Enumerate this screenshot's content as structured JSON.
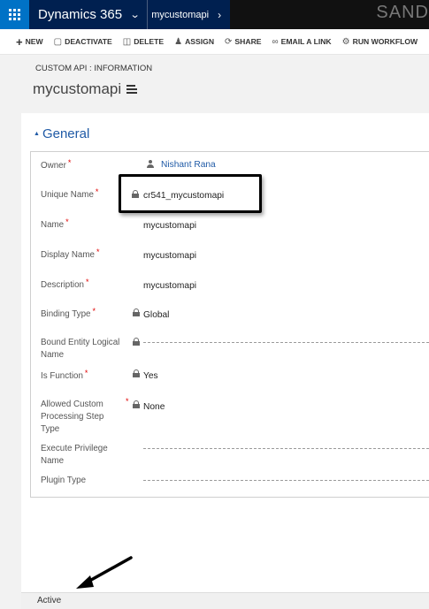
{
  "nav": {
    "app_name": "Dynamics 365",
    "breadcrumb": "mycustomapi",
    "environment": "SAND"
  },
  "commands": [
    {
      "label": "NEW",
      "icon": "plus-icon"
    },
    {
      "label": "DEACTIVATE",
      "icon": "deactivate-icon"
    },
    {
      "label": "DELETE",
      "icon": "trash-icon"
    },
    {
      "label": "ASSIGN",
      "icon": "assign-icon"
    },
    {
      "label": "SHARE",
      "icon": "share-icon"
    },
    {
      "label": "EMAIL A LINK",
      "icon": "link-icon"
    },
    {
      "label": "RUN WORKFLOW",
      "icon": "workflow-icon"
    }
  ],
  "header": {
    "entity_type": "CUSTOM API : INFORMATION",
    "record_title": "mycustomapi"
  },
  "section": {
    "title": "General"
  },
  "fields": {
    "owner": {
      "label": "Owner",
      "value": "Nishant Rana"
    },
    "unique_name": {
      "label": "Unique Name",
      "value": "cr541_mycustomapi"
    },
    "name": {
      "label": "Name",
      "value": "mycustomapi"
    },
    "display_name": {
      "label": "Display Name",
      "value": "mycustomapi"
    },
    "description": {
      "label": "Description",
      "value": "mycustomapi"
    },
    "binding_type": {
      "label": "Binding Type",
      "value": "Global"
    },
    "bound_entity": {
      "label_1": "Bound Entity Logical",
      "label_2": "Name",
      "value": ""
    },
    "is_function": {
      "label": "Is Function",
      "value": "Yes"
    },
    "allowed_step": {
      "label_1": "Allowed Custom",
      "label_2": "Processing Step",
      "label_3": "Type",
      "value": "None"
    },
    "execute_privilege": {
      "label_1": "Execute Privilege",
      "label_2": "Name",
      "value": ""
    },
    "plugin_type": {
      "label": "Plugin Type",
      "value": ""
    }
  },
  "required_marker": "*",
  "status": {
    "text": "Active"
  },
  "colors": {
    "nav_bg": "#002050",
    "waffle_bg": "#0072c6",
    "link": "#1f5aa6",
    "required": "#e00000"
  }
}
